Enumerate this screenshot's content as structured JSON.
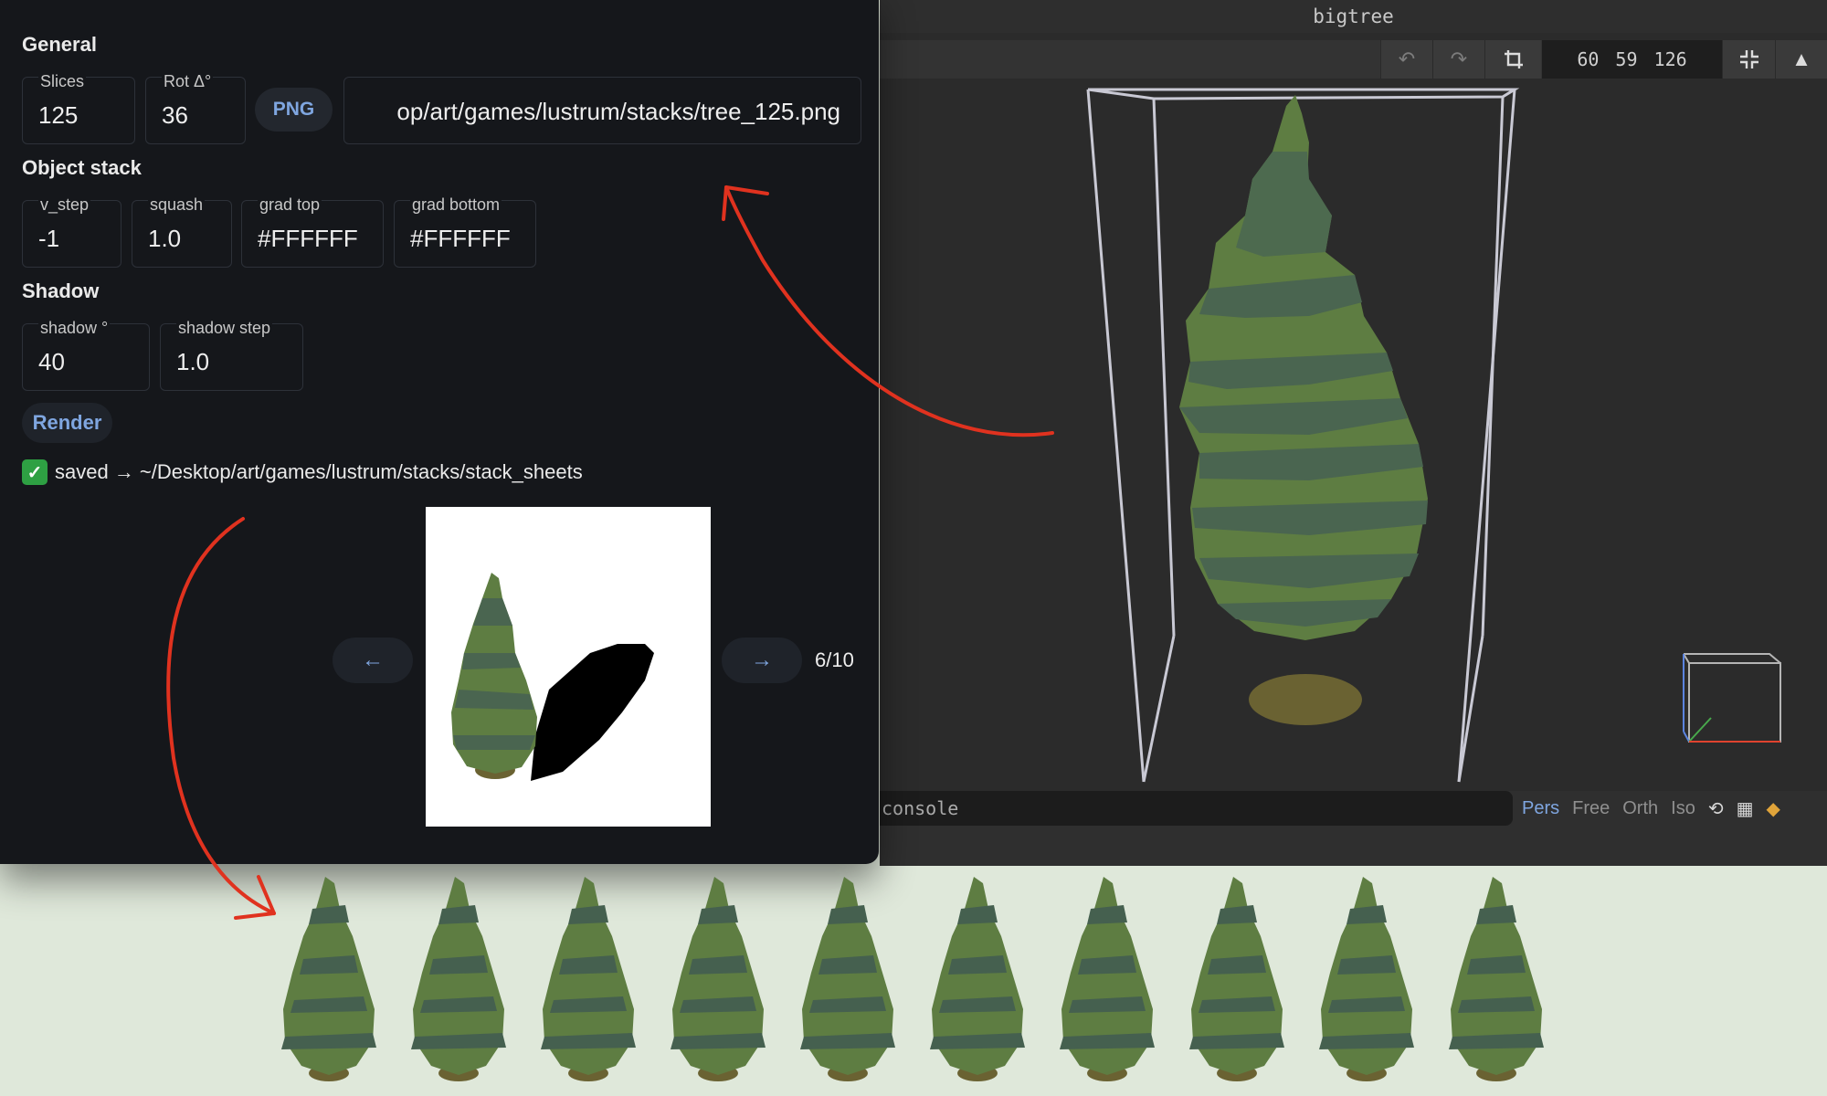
{
  "voxel_window": {
    "title": "bigtree",
    "toolbar": {
      "undo_icon": "undo-arrow-icon",
      "redo_icon": "redo-arrow-icon",
      "crop_icon": "crop-icon",
      "dimensions": "60 59 126",
      "collapse_icon": "collapse-arrows-icon",
      "up_icon": "triangle-up-icon"
    },
    "console_placeholder": "console",
    "view_modes": [
      "Pers",
      "Free",
      "Orth",
      "Iso"
    ],
    "active_view_mode": "Pers"
  },
  "panel": {
    "general": {
      "heading": "General",
      "slices_label": "Slices",
      "slices_value": "125",
      "rot_label": "Rot Δ°",
      "rot_value": "36",
      "format_button": "PNG",
      "output_path": "op/art/games/lustrum/stacks/tree_125.png"
    },
    "object_stack": {
      "heading": "Object stack",
      "v_step_label": "v_step",
      "v_step_value": "-1",
      "squash_label": "squash",
      "squash_value": "1.0",
      "grad_top_label": "grad top",
      "grad_top_value": "#FFFFFF",
      "grad_bottom_label": "grad bottom",
      "grad_bottom_value": "#FFFFFF"
    },
    "shadow": {
      "heading": "Shadow",
      "angle_label": "shadow °",
      "angle_value": "40",
      "step_label": "shadow step",
      "step_value": "1.0"
    },
    "render_button": "Render",
    "status_text": "saved → ~/Desktop/art/games/lustrum/stacks/stack_sheets",
    "preview": {
      "prev_label": "←",
      "next_label": "→",
      "page": "6/10"
    }
  },
  "colors": {
    "accent_blue": "#7fa6e0",
    "annotation_red": "#e0321f",
    "tree_green": "#5e7d42",
    "tree_dark": "#45604f",
    "trunk": "#6a6232",
    "sheet_background": "#dfe8da"
  }
}
